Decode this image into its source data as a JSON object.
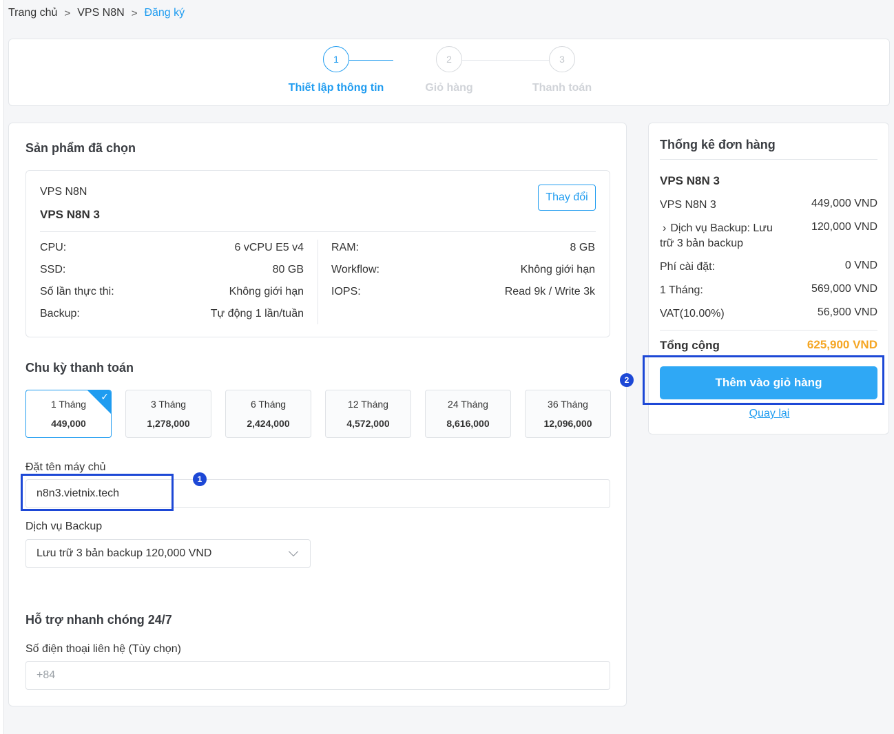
{
  "breadcrumb": {
    "items": [
      "Trang chủ",
      "VPS N8N"
    ],
    "current": "Đăng ký",
    "separator": ">"
  },
  "steps": [
    {
      "number": "1",
      "label": "Thiết lập thông tin",
      "active": true
    },
    {
      "number": "2",
      "label": "Giỏ hàng",
      "active": false
    },
    {
      "number": "3",
      "label": "Thanh toán",
      "active": false
    }
  ],
  "product_section": {
    "title": "Sản phẩm đã chọn",
    "category": "VPS N8N",
    "name": "VPS N8N 3",
    "change_label": "Thay đổi",
    "specs_left": [
      {
        "label": "CPU:",
        "value": "6 vCPU E5 v4"
      },
      {
        "label": "SSD:",
        "value": "80 GB"
      },
      {
        "label": "Số lần thực thi:",
        "value": "Không giới hạn"
      },
      {
        "label": "Backup:",
        "value": "Tự động 1 lần/tuần"
      }
    ],
    "specs_right": [
      {
        "label": "RAM:",
        "value": "8 GB"
      },
      {
        "label": "Workflow:",
        "value": "Không giới hạn"
      },
      {
        "label": "IOPS:",
        "value": "Read 9k / Write 3k"
      }
    ]
  },
  "billing": {
    "title": "Chu kỳ thanh toán",
    "cycles": [
      {
        "label": "1 Tháng",
        "price": "449,000",
        "selected": true
      },
      {
        "label": "3 Tháng",
        "price": "1,278,000",
        "selected": false
      },
      {
        "label": "6 Tháng",
        "price": "2,424,000",
        "selected": false
      },
      {
        "label": "12 Tháng",
        "price": "4,572,000",
        "selected": false
      },
      {
        "label": "24 Tháng",
        "price": "8,616,000",
        "selected": false
      },
      {
        "label": "36 Tháng",
        "price": "12,096,000",
        "selected": false
      }
    ],
    "selected_check": "✓"
  },
  "hostname": {
    "label": "Đặt tên máy chủ",
    "value": "n8n3.vietnix.tech"
  },
  "backup": {
    "label": "Dịch vụ Backup",
    "selected": "Lưu trữ 3 bản backup 120,000 VND"
  },
  "support": {
    "title": "Hỗ trợ nhanh chóng 24/7",
    "phone_label": "Số điện thoại liên hệ (Tùy chọn)",
    "phone_placeholder": "+84"
  },
  "annotations": {
    "badge_1": "1",
    "badge_2": "2",
    "highlight_color": "#1d48d6"
  },
  "summary": {
    "title": "Thống kê đơn hàng",
    "product": "VPS N8N 3",
    "rows": [
      {
        "label": "VPS N8N 3",
        "value": "449,000 VND"
      },
      {
        "label": "Dịch vụ Backup: Lưu trữ 3 bản backup",
        "value": "120,000 VND",
        "prefix": "›"
      },
      {
        "label": "Phí cài đặt:",
        "value": "0 VND"
      },
      {
        "label": "1 Tháng:",
        "value": "569,000 VND"
      },
      {
        "label": "VAT(10.00%)",
        "value": "56,900 VND"
      }
    ],
    "total_label": "Tổng cộng",
    "total_value": "625,900 VND",
    "add_to_cart": "Thêm vào giỏ hàng",
    "back": "Quay lại"
  },
  "colors": {
    "accent": "#1f9cf0",
    "button": "#2fa8f5",
    "total": "#f5a623"
  }
}
